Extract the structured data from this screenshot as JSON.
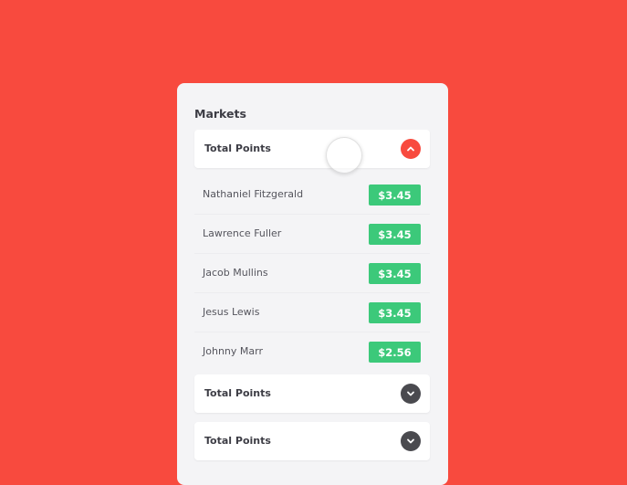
{
  "panel": {
    "title": "Markets"
  },
  "markets": [
    {
      "label": "Total Points",
      "state": "expanded",
      "toggle_icon": "chevron-up-icon"
    },
    {
      "label": "Total Points",
      "state": "collapsed",
      "toggle_icon": "chevron-down-icon"
    },
    {
      "label": "Total Points",
      "state": "collapsed",
      "toggle_icon": "chevron-down-icon"
    }
  ],
  "selections": [
    {
      "name": "Nathaniel Fitzgerald",
      "price": "$3.45"
    },
    {
      "name": "Lawrence Fuller",
      "price": "$3.45"
    },
    {
      "name": "Jacob Mullins",
      "price": "$3.45"
    },
    {
      "name": "Jesus Lewis",
      "price": "$3.45"
    },
    {
      "name": "Johnny Marr",
      "price": "$2.56"
    }
  ],
  "colors": {
    "background": "#f84a3e",
    "price_badge": "#3cc97a",
    "toggle_open": "#f84a3e",
    "toggle_closed": "#4a4a4f"
  }
}
